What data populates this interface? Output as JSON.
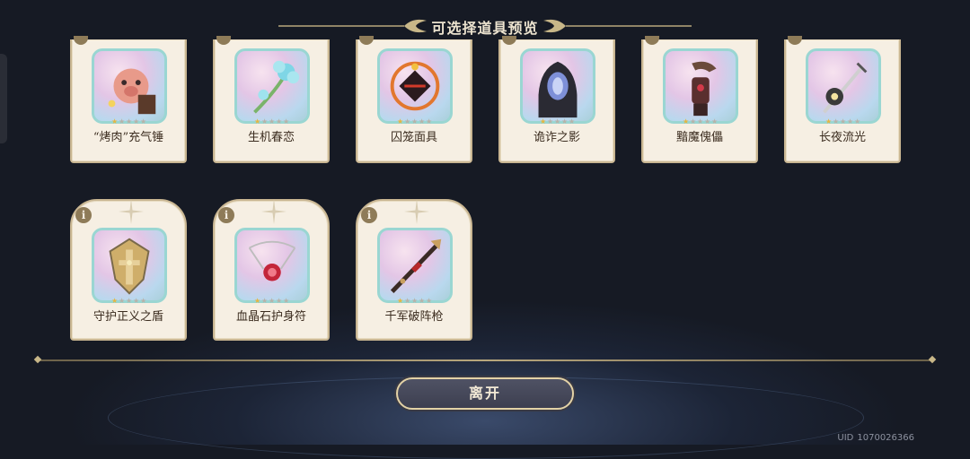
{
  "header": {
    "title": "可选择道具预览"
  },
  "items": [
    {
      "name": "“烤肉”充气锤",
      "stars": 1,
      "icon": "pig-hammer-icon"
    },
    {
      "name": "生机春恋",
      "stars": 1,
      "icon": "flower-wand-icon"
    },
    {
      "name": "囚笼面具",
      "stars": 1,
      "icon": "cage-mask-icon"
    },
    {
      "name": "诡诈之影",
      "stars": 1,
      "icon": "hooded-shadow-icon"
    },
    {
      "name": "黯魔傀儡",
      "stars": 1,
      "icon": "dark-puppet-icon"
    },
    {
      "name": "长夜流光",
      "stars": 1,
      "icon": "lantern-staff-icon"
    },
    {
      "name": "守护正义之盾",
      "stars": 1,
      "icon": "shield-icon"
    },
    {
      "name": "血晶石护身符",
      "stars": 1,
      "icon": "amulet-icon"
    },
    {
      "name": "千军破阵枪",
      "stars": 1,
      "icon": "spear-icon"
    }
  ],
  "star_max": 5,
  "info_label": "i",
  "leave_button": {
    "label": "离开"
  },
  "uid": {
    "label": "UID",
    "value": "1070026366"
  },
  "colors": {
    "card": "#f6efe3",
    "card_border": "#c9b692",
    "frame": "#9ad6d2",
    "star_on": "#e5b640",
    "background": "#181c26"
  }
}
